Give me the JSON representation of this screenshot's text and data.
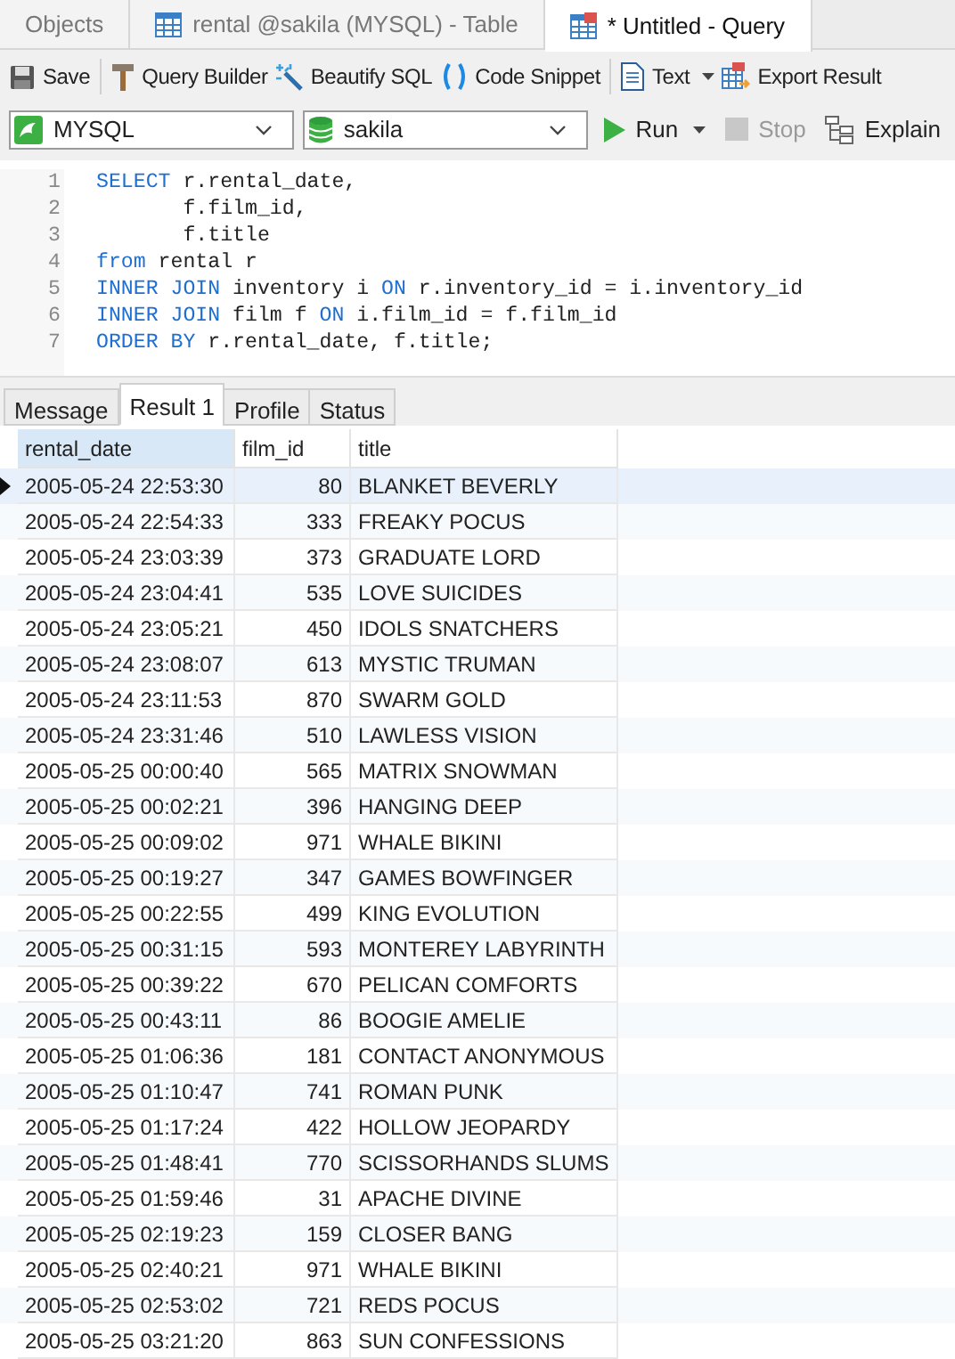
{
  "doc_tabs": [
    {
      "label": "Objects",
      "kind": "plain",
      "selected": false
    },
    {
      "label": "rental @sakila (MYSQL) - Table",
      "kind": "table",
      "selected": false
    },
    {
      "label": "* Untitled - Query",
      "kind": "query",
      "selected": true
    }
  ],
  "toolbar": [
    {
      "label": "Save",
      "kind": "save"
    },
    {
      "label": "Query Builder",
      "kind": "builder"
    },
    {
      "label": "Beautify SQL",
      "kind": "beautify"
    },
    {
      "label": "Code Snippet",
      "kind": "snippet"
    },
    {
      "label": "Text",
      "kind": "text"
    },
    {
      "label": "Export Result",
      "kind": "export"
    }
  ],
  "connection": {
    "value": "MYSQL"
  },
  "database": {
    "value": "sakila"
  },
  "run_controls": [
    {
      "label": "Run",
      "kind": "run",
      "disabled": false
    },
    {
      "label": "Stop",
      "kind": "stop",
      "disabled": true
    },
    {
      "label": "Explain",
      "kind": "explain",
      "disabled": false
    }
  ],
  "editor": {
    "lines": [
      {
        "number": "1",
        "tokens": [
          {
            "text": "SELECT",
            "kind": "keyword"
          },
          {
            "text": " r.rental_date,",
            "kind": "plain"
          }
        ]
      },
      {
        "number": "2",
        "tokens": [
          {
            "text": "       f.film_id,",
            "kind": "plain"
          }
        ]
      },
      {
        "number": "3",
        "tokens": [
          {
            "text": "       f.title",
            "kind": "plain"
          }
        ]
      },
      {
        "number": "4",
        "tokens": [
          {
            "text": "from",
            "kind": "keyword"
          },
          {
            "text": " rental r",
            "kind": "plain"
          }
        ]
      },
      {
        "number": "5",
        "tokens": [
          {
            "text": "INNER JOIN",
            "kind": "keyword"
          },
          {
            "text": " inventory i ",
            "kind": "plain"
          },
          {
            "text": "ON",
            "kind": "keyword"
          },
          {
            "text": " r.inventory_id = i.inventory_id",
            "kind": "plain"
          }
        ]
      },
      {
        "number": "6",
        "tokens": [
          {
            "text": "INNER JOIN",
            "kind": "keyword"
          },
          {
            "text": " film f ",
            "kind": "plain"
          },
          {
            "text": "ON",
            "kind": "keyword"
          },
          {
            "text": " i.film_id = f.film_id",
            "kind": "plain"
          }
        ]
      },
      {
        "number": "7",
        "tokens": [
          {
            "text": "ORDER BY",
            "kind": "keyword"
          },
          {
            "text": " r.rental_date, f.title;",
            "kind": "plain"
          }
        ]
      }
    ]
  },
  "result_tabs": [
    {
      "label": "Message",
      "selected": false
    },
    {
      "label": "Result 1",
      "selected": true
    },
    {
      "label": "Profile",
      "selected": false
    },
    {
      "label": "Status",
      "selected": false
    }
  ],
  "table": {
    "columns": [
      {
        "label": "rental_date",
        "selected": true
      },
      {
        "label": "film_id",
        "selected": false
      },
      {
        "label": "title",
        "selected": false
      }
    ],
    "rows": [
      {
        "selected": true,
        "cells": [
          "2005-05-24 22:53:30",
          "80",
          "BLANKET BEVERLY"
        ]
      },
      {
        "selected": false,
        "cells": [
          "2005-05-24 22:54:33",
          "333",
          "FREAKY POCUS"
        ]
      },
      {
        "selected": false,
        "cells": [
          "2005-05-24 23:03:39",
          "373",
          "GRADUATE LORD"
        ]
      },
      {
        "selected": false,
        "cells": [
          "2005-05-24 23:04:41",
          "535",
          "LOVE SUICIDES"
        ]
      },
      {
        "selected": false,
        "cells": [
          "2005-05-24 23:05:21",
          "450",
          "IDOLS SNATCHERS"
        ]
      },
      {
        "selected": false,
        "cells": [
          "2005-05-24 23:08:07",
          "613",
          "MYSTIC TRUMAN"
        ]
      },
      {
        "selected": false,
        "cells": [
          "2005-05-24 23:11:53",
          "870",
          "SWARM GOLD"
        ]
      },
      {
        "selected": false,
        "cells": [
          "2005-05-24 23:31:46",
          "510",
          "LAWLESS VISION"
        ]
      },
      {
        "selected": false,
        "cells": [
          "2005-05-25 00:00:40",
          "565",
          "MATRIX SNOWMAN"
        ]
      },
      {
        "selected": false,
        "cells": [
          "2005-05-25 00:02:21",
          "396",
          "HANGING DEEP"
        ]
      },
      {
        "selected": false,
        "cells": [
          "2005-05-25 00:09:02",
          "971",
          "WHALE BIKINI"
        ]
      },
      {
        "selected": false,
        "cells": [
          "2005-05-25 00:19:27",
          "347",
          "GAMES BOWFINGER"
        ]
      },
      {
        "selected": false,
        "cells": [
          "2005-05-25 00:22:55",
          "499",
          "KING EVOLUTION"
        ]
      },
      {
        "selected": false,
        "cells": [
          "2005-05-25 00:31:15",
          "593",
          "MONTEREY LABYRINTH"
        ]
      },
      {
        "selected": false,
        "cells": [
          "2005-05-25 00:39:22",
          "670",
          "PELICAN COMFORTS"
        ]
      },
      {
        "selected": false,
        "cells": [
          "2005-05-25 00:43:11",
          "86",
          "BOOGIE AMELIE"
        ]
      },
      {
        "selected": false,
        "cells": [
          "2005-05-25 01:06:36",
          "181",
          "CONTACT ANONYMOUS"
        ]
      },
      {
        "selected": false,
        "cells": [
          "2005-05-25 01:10:47",
          "741",
          "ROMAN PUNK"
        ]
      },
      {
        "selected": false,
        "cells": [
          "2005-05-25 01:17:24",
          "422",
          "HOLLOW JEOPARDY"
        ]
      },
      {
        "selected": false,
        "cells": [
          "2005-05-25 01:48:41",
          "770",
          "SCISSORHANDS SLUMS"
        ]
      },
      {
        "selected": false,
        "cells": [
          "2005-05-25 01:59:46",
          "31",
          "APACHE DIVINE"
        ]
      },
      {
        "selected": false,
        "cells": [
          "2005-05-25 02:19:23",
          "159",
          "CLOSER BANG"
        ]
      },
      {
        "selected": false,
        "cells": [
          "2005-05-25 02:40:21",
          "971",
          "WHALE BIKINI"
        ]
      },
      {
        "selected": false,
        "cells": [
          "2005-05-25 02:53:02",
          "721",
          "REDS POCUS"
        ]
      },
      {
        "selected": false,
        "cells": [
          "2005-05-25 03:21:20",
          "863",
          "SUN CONFESSIONS"
        ]
      }
    ]
  }
}
